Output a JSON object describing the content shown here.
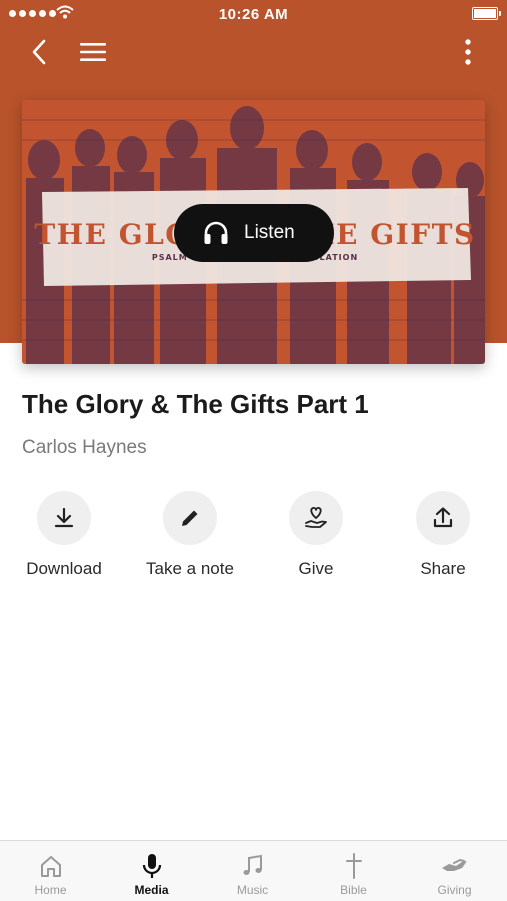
{
  "status_bar": {
    "time": "10:26 AM"
  },
  "artwork": {
    "headline": "THE GLORY & THE GIFTS",
    "subline": "PSALM 96 · NEW LIVING TRANSLATION",
    "colors": {
      "overlay": "#c25430",
      "dark": "#3a2a55"
    }
  },
  "listen_button": {
    "label": "Listen"
  },
  "media": {
    "title": "The Glory & The Gifts Part 1",
    "speaker": "Carlos Haynes"
  },
  "actions": [
    {
      "label": "Download",
      "icon": "download-icon"
    },
    {
      "label": "Take a note",
      "icon": "pencil-icon"
    },
    {
      "label": "Give",
      "icon": "heart-hand-icon"
    },
    {
      "label": "Share",
      "icon": "share-icon"
    }
  ],
  "tabs": [
    {
      "label": "Home",
      "icon": "home-icon",
      "active": false
    },
    {
      "label": "Media",
      "icon": "microphone-icon",
      "active": true
    },
    {
      "label": "Music",
      "icon": "music-note-icon",
      "active": false
    },
    {
      "label": "Bible",
      "icon": "cross-icon",
      "active": false
    },
    {
      "label": "Giving",
      "icon": "giving-hand-icon",
      "active": false
    }
  ],
  "colors": {
    "header": "#b8532c",
    "active_tab": "#111111",
    "inactive_tab": "#9a9a9a"
  }
}
